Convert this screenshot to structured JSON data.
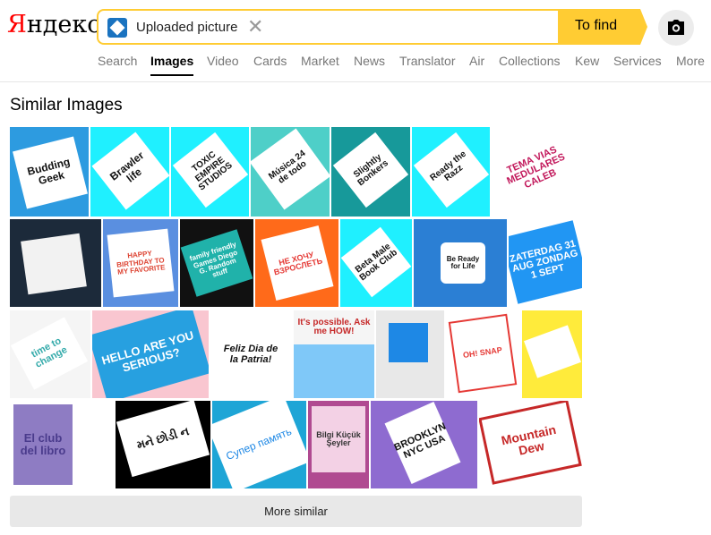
{
  "logo": {
    "first": "Я",
    "rest": "ндекс"
  },
  "search": {
    "chip_label": "Uploaded picture",
    "find_label": "To find",
    "clear_icon": "close-icon",
    "camera_icon": "camera-icon"
  },
  "nav": [
    "Search",
    "Images",
    "Video",
    "Cards",
    "Market",
    "News",
    "Translator",
    "Air",
    "Collections",
    "Kew",
    "Services",
    "More"
  ],
  "nav_active": "Images",
  "section_title": "Similar Images",
  "tiles": {
    "t1": "Budding Geek",
    "t2": "Brawler life",
    "t3": "TOXIC EMPIRE STUDIOS",
    "t4": "Música 24 de todo",
    "t5": "Slightly Bonkers",
    "t6": "Ready the Razz",
    "t7": "TEMA VIAS MEDULARES CALEB",
    "t10": "HAPPY BIRTHDAY TO MY FAVORITE",
    "t11": "family friendly Games Diego G. Random stuff",
    "t12": "НЕ ХОЧУ ВЗРОСЛЕТЬ",
    "t13": "Beta Male Book Club",
    "t14": "Be Ready for Life",
    "t15": "ZATERDAG 31 AUG ZONDAG 1 SEPT",
    "t16": "time to change",
    "t17": "HELLO ARE YOU SERIOUS?",
    "t18": "Feliz Dia de la Patria!",
    "t19": "It's possible. Ask me HOW!",
    "t22": "OH! SNAP",
    "t23": "El club del libro",
    "t24": "મને છોડી ન",
    "t25": "Супер память",
    "t26": "Bilgi Küçük Şeyler",
    "t27": "BROOKLYN NYC USA",
    "t28": "Mountain Dew"
  },
  "more_label": "More similar"
}
